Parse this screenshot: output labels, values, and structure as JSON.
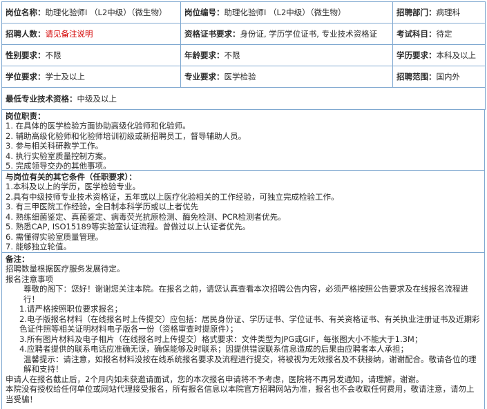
{
  "info_table": {
    "row1": [
      {
        "label": "岗位名称：",
        "value": "助理化验师I （L2中级）（微生物）"
      },
      {
        "label": "岗位编号：",
        "value": "助理化验师I （L2中级）（微生物）"
      },
      {
        "label": "招聘部门：",
        "value": "病理科"
      }
    ],
    "row2": [
      {
        "label": "招聘人数：",
        "value": "请见备注说明"
      },
      {
        "label": "资格证书要求：",
        "value": "身份证, 学历学位证书, 专业技术资格证"
      },
      {
        "label": "考试科目：",
        "value": "待定"
      }
    ],
    "row3": [
      {
        "label": "性别要求：",
        "value": "不限"
      },
      {
        "label": "年龄要求：",
        "value": "不限"
      },
      {
        "label": "学历要求：",
        "value": "本科及以上"
      }
    ],
    "row4": [
      {
        "label": "学位要求：",
        "value": "学士及以上"
      },
      {
        "label": "专业要求：",
        "value": "医学检验"
      },
      {
        "label": "招聘范围：",
        "value": "国内外"
      }
    ],
    "row5": {
      "label": "最低专业技术资格：",
      "value": "中级及以上"
    }
  },
  "duties": {
    "heading": "岗位职责：",
    "items": [
      "1.  在具体的医学检验方面协助高级化验师和化验师。",
      "2.  辅助高级化验师和化验师培训初级或新招聘员工，督导辅助人员。",
      "3.  参与相关科研教学工作。",
      "4.  执行实验室质量控制方案。",
      "5.  完成领导交办的其他事项。"
    ]
  },
  "conditions": {
    "heading": "与岗位有关的其它条件（任职要求）：",
    "items": [
      "1.本科及以上的学历，医学检验专业。",
      "2.具有中级技师专业技术资格证，五年或以上医疗化验相关的工作经验，可独立完成检验工作。",
      "3.  有三甲医院工作经验，全日制本科学历或以上者优先",
      "4.  熟练细菌鉴定、真菌鉴定、病毒荧光抗原检测、酶免检测、PCR检测者优先。",
      "5.  熟悉CAP, ISO15189等实验室认证流程。曾做过以上认证者优先。",
      "6.  需懂得实验室质量管理。",
      "7.  能够独立轮值。"
    ]
  },
  "notes": {
    "heading": "备注：",
    "line1": "招聘数量根据医疗服务发展待定。",
    "line2": "报名注意事项",
    "greeting": "尊敬的阁下：您好！谢谢您关注本院。在报名之前，请您认真查看本次招聘公告内容，必须严格按照公告要求及在线报名流程进行！",
    "n1": "1.请严格按照职位要求报名；",
    "n2": "2.电子版报名材料（在线报名时上传提交）应包括：居民身份证、学历证书、学位证书、有关资格证书、有关执业注册证书及近期彩色证件照等相关证明材料电子版各一份（资格审查时提原件）；",
    "n3": "3.所有图片材料及电子相片（在线报名时上传提交）格式要求：文件类型为JPG或GIF，每张图大小不能大于1.3M；",
    "n4": "4.应聘者提供的联系电话应准确无误，确保能够及时联系；因提供错误联系信息造成的后果由应聘者本人承担；",
    "tip": "温馨提示：请注意，如报名材料没按在线系统报名要求及流程进行提交，将被视为无效报名及不获接纳，谢谢配合。敬请各位的理解和支持！",
    "p1": "申请人在报名截止后，2个月内如未获邀请面试，您的本次报名申请将不予考虑，医院将不再另发通知，请理解，谢谢。",
    "p2": "本院没有授权给任何单位或网站代理接受报名，所有报名信息以本院官方招聘网站为准，报名也不会收取任何费用，敬请注意，请勿上当受骗！"
  }
}
